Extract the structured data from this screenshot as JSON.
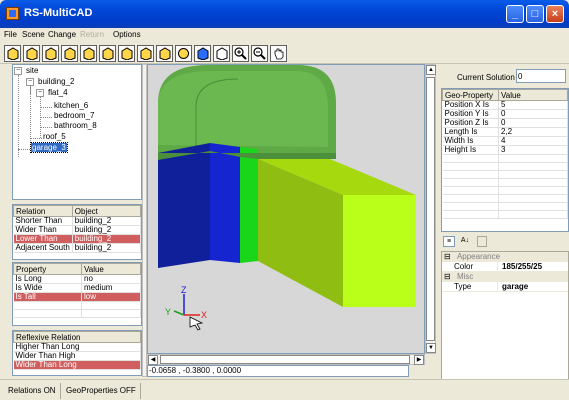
{
  "window": {
    "title": "RS-MultiCAD",
    "minimize": "_",
    "maximize": "□",
    "close": "×"
  },
  "menu": [
    "File",
    "Scene",
    "Change",
    "Return",
    "Options"
  ],
  "toolbar_icons": [
    "cube-icon",
    "cube-icon",
    "cube-icon",
    "cube-icon",
    "cube-icon",
    "cube-icon",
    "cube-icon",
    "cube-icon",
    "cube-icon",
    "sphere-icon",
    "cube-blue-icon",
    "cube-icon",
    "zoom-in-icon",
    "zoom-out-icon",
    "hand-icon"
  ],
  "tree": {
    "nodes": [
      "site",
      "building_2",
      "flat_4",
      "kitchen_6",
      "bedroom_7",
      "bathroom_8",
      "roof_5",
      "garage_3"
    ],
    "expander_open": "−"
  },
  "relations": {
    "headers": [
      "Relation",
      "Object"
    ],
    "rows": [
      [
        "Shorter Than",
        "building_2"
      ],
      [
        "Wider Than",
        "building_2"
      ],
      [
        "Lower Than",
        "building_2"
      ],
      [
        "Adjacent South",
        "building_2"
      ]
    ]
  },
  "properties": {
    "headers": [
      "Property",
      "Value"
    ],
    "rows": [
      [
        "Is Long",
        "no"
      ],
      [
        "Is Wide",
        "medium"
      ],
      [
        "Is Tall",
        "low"
      ]
    ]
  },
  "reflexive": {
    "header": "Reflexive Relation",
    "rows": [
      "Higher Than Long",
      "Wider Than High",
      "Wider Than Long"
    ]
  },
  "axes": {
    "x": "X",
    "y": "Y",
    "z": "Z"
  },
  "coordinates": "-0.0658 , -0.3800 , 0.0000",
  "current_solution": {
    "label": "Current Solution",
    "value": "0"
  },
  "geo": {
    "headers": [
      "Geo-Property",
      "Value"
    ],
    "rows": [
      [
        "Position X Is",
        "5"
      ],
      [
        "Position Y Is",
        "0"
      ],
      [
        "Position Z Is",
        "0"
      ],
      [
        "Length Is",
        "2,2"
      ],
      [
        "Width Is",
        "4"
      ],
      [
        "Height Is",
        "3"
      ]
    ]
  },
  "property_grid": {
    "categories": [
      {
        "name": "Appearance",
        "items": [
          {
            "key": "Color",
            "value": "185/255/25"
          }
        ]
      },
      {
        "name": "Misc",
        "items": [
          {
            "key": "Type",
            "value": "garage"
          }
        ]
      }
    ],
    "collapse": "⊟"
  },
  "status": [
    "Relations ON",
    "GeoProperties OFF"
  ],
  "colors": {
    "highlight": "#d05e5e",
    "selection": "#316ac5",
    "garage": "#b9ff19"
  }
}
